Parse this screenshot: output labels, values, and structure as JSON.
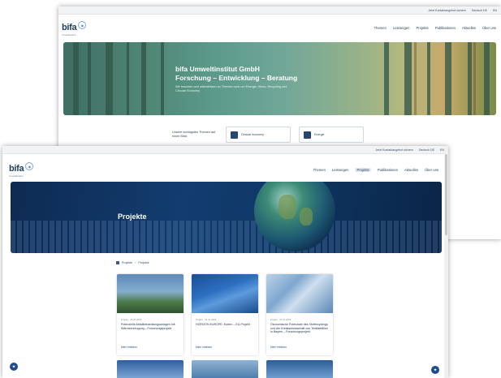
{
  "back": {
    "topbar": [
      "Jetzt Kontaktangebot sichern",
      "Deutsch DE",
      "EN"
    ],
    "logo": {
      "text": "bifa",
      "sub": "Umweltinstitut"
    },
    "nav": [
      "Themen",
      "Leistungen",
      "Projekte",
      "Publikationen",
      "Aktuelles",
      "Über uns"
    ],
    "hero": {
      "title_line1": "bifa Umweltinstitut GmbH",
      "title_line2": "Forschung – Entwicklung – Beratung",
      "subtitle": "Wir forschen und unterstützen zu Themen rund um Energie, Klima, Recycling und Circular Economy"
    },
    "topics": {
      "label": "Unsere wichtigsten Themen auf einen Blick",
      "items": [
        "Circular economy",
        "Energie"
      ]
    }
  },
  "front": {
    "topbar": [
      "Jetzt Kontaktangebot sichern",
      "Deutsch DE",
      "EN"
    ],
    "logo": {
      "text": "bifa",
      "sub": "Umweltinstitut"
    },
    "nav": [
      "Themen",
      "Leistungen",
      "Projekte",
      "Publikationen",
      "Aktuelles",
      "Über uns"
    ],
    "hero": {
      "title": "Projekte"
    },
    "breadcrumb": [
      "Projekte",
      "Projekte"
    ],
    "projects": [
      {
        "date": "Projekt · 01.06.2023",
        "title": "Potenzielle Abfallbehandlungsanlagen mit Wärmeerzeugung – Forschungsprojekt",
        "more": "Mehr erfahren"
      },
      {
        "date": "Projekt · 01.01.2023",
        "title": "HORIZON EUROPE: Eutern – EU-Projekt",
        "more": "Mehr erfahren"
      },
      {
        "date": "Projekt · 01.01.2023",
        "title": "Ökonomische Potenziale des Stoffrecyclings und der Kreislaufwirtschaft von Textilabfällen in Bayern – Forschungsprojekt",
        "more": "Mehr erfahren"
      }
    ]
  },
  "colors": {
    "brand": "#1f4b8a",
    "navy": "#1c2f4a",
    "hero_blue": "#133d70"
  }
}
